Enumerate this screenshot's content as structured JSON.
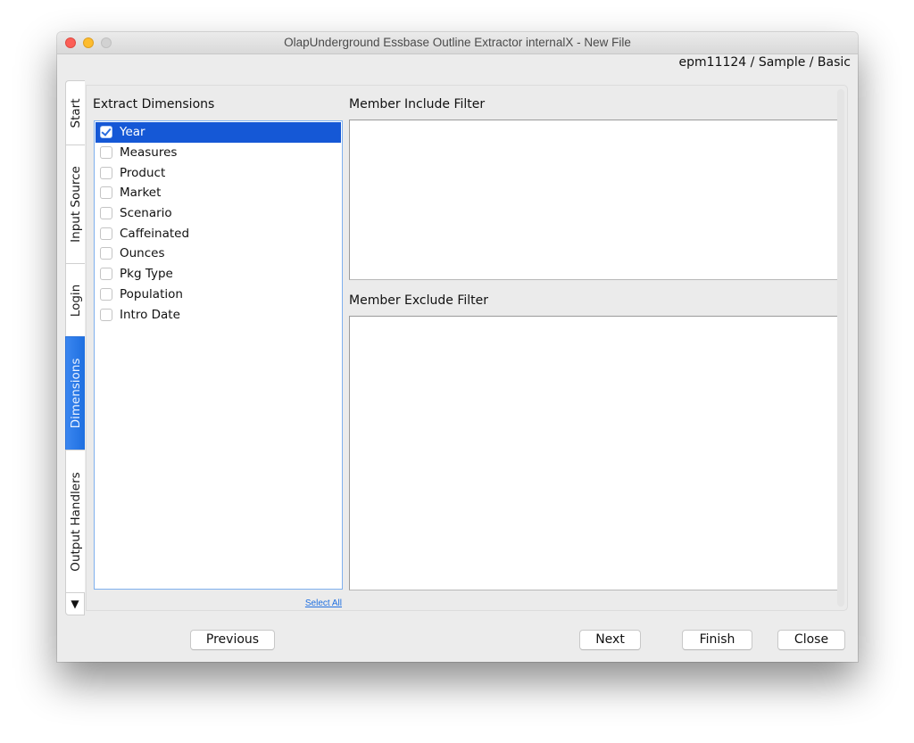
{
  "window": {
    "title": "OlapUnderground Essbase Outline Extractor internalX - New File",
    "context_path": "epm11124 / Sample / Basic"
  },
  "tabs": [
    {
      "label": "Start",
      "active": false
    },
    {
      "label": "Input Source",
      "active": false
    },
    {
      "label": "Login",
      "active": false
    },
    {
      "label": "Dimensions",
      "active": true
    },
    {
      "label": "Output Handlers",
      "active": false
    }
  ],
  "tab_scroll_icon": "▼",
  "dimensions": {
    "label": "Extract Dimensions",
    "items": [
      {
        "label": "Year",
        "checked": true,
        "selected": true
      },
      {
        "label": "Measures",
        "checked": false,
        "selected": false
      },
      {
        "label": "Product",
        "checked": false,
        "selected": false
      },
      {
        "label": "Market",
        "checked": false,
        "selected": false
      },
      {
        "label": "Scenario",
        "checked": false,
        "selected": false
      },
      {
        "label": "Caffeinated",
        "checked": false,
        "selected": false
      },
      {
        "label": "Ounces",
        "checked": false,
        "selected": false
      },
      {
        "label": "Pkg Type",
        "checked": false,
        "selected": false
      },
      {
        "label": "Population",
        "checked": false,
        "selected": false
      },
      {
        "label": "Intro Date",
        "checked": false,
        "selected": false
      }
    ],
    "select_all_label": "Select All"
  },
  "include_filter": {
    "label": "Member Include Filter",
    "value": ""
  },
  "exclude_filter": {
    "label": "Member Exclude Filter",
    "value": ""
  },
  "buttons": {
    "previous": "Previous",
    "next": "Next",
    "finish": "Finish",
    "close": "Close"
  }
}
